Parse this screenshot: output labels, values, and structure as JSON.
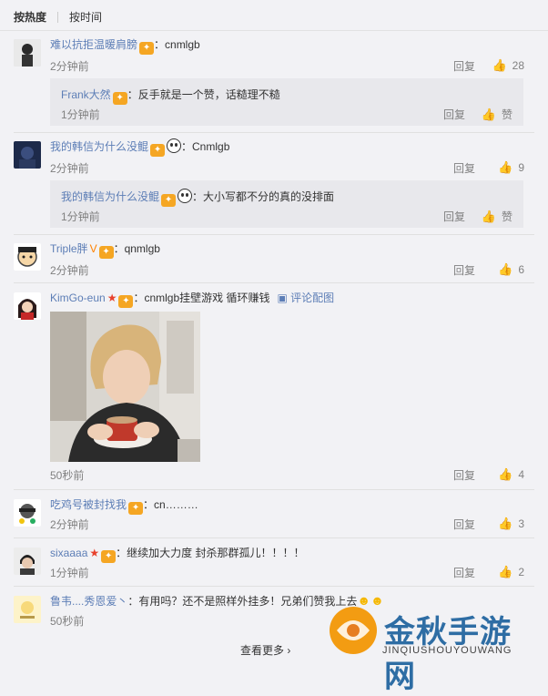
{
  "sort": {
    "hot": "按热度",
    "time": "按时间"
  },
  "comments": [
    {
      "user": "难以抗拒温暖肩膀",
      "text": "：cnmlgb",
      "time": "2分钟前",
      "reply": "回复",
      "likes": "28"
    },
    {
      "user": "我的韩信为什么没鲲",
      "text": "：Cnmlgb",
      "time": "2分钟前",
      "reply": "回复",
      "likes": "9"
    },
    {
      "user": "Triple胖",
      "text": "：qnmlgb",
      "time": "2分钟前",
      "reply": "回复",
      "likes": "6"
    },
    {
      "user": "KimGo-eun",
      "text": "：cnmlgb挂壁游戏 循环赚钱",
      "pic_link": "评论配图",
      "time": "50秒前",
      "reply": "回复",
      "likes": "4"
    },
    {
      "user": "吃鸡号被封找我",
      "text": "：cn………",
      "time": "2分钟前",
      "reply": "回复",
      "likes": "3"
    },
    {
      "user": "sixaaaa",
      "text": "：继续加大力度  封杀那群孤儿！！！！",
      "time": "1分钟前",
      "reply": "回复",
      "likes": "2"
    },
    {
      "user": "鲁韦....秀恩爱丶",
      "text": "：有用吗？还不是照样外挂多！兄弟们赞我上去",
      "time": "50秒前"
    }
  ],
  "replies": [
    {
      "user": "Frank大然",
      "text": "：反手就是一个赞，话糙理不糙",
      "time": "1分钟前",
      "reply": "回复",
      "likes": "赞"
    },
    {
      "user": "我的韩信为什么没鲲",
      "text": "：大小写都不分的真的没排面",
      "time": "1分钟前",
      "reply": "回复",
      "likes": "赞"
    }
  ],
  "more": "查看更多",
  "watermark": {
    "title": "金秋手游网",
    "sub": "JINQIUSHOUYOUWANG"
  },
  "colors": {
    "link": "#5d7eb6",
    "badge": "#f5a623",
    "star": "#e8412c"
  }
}
